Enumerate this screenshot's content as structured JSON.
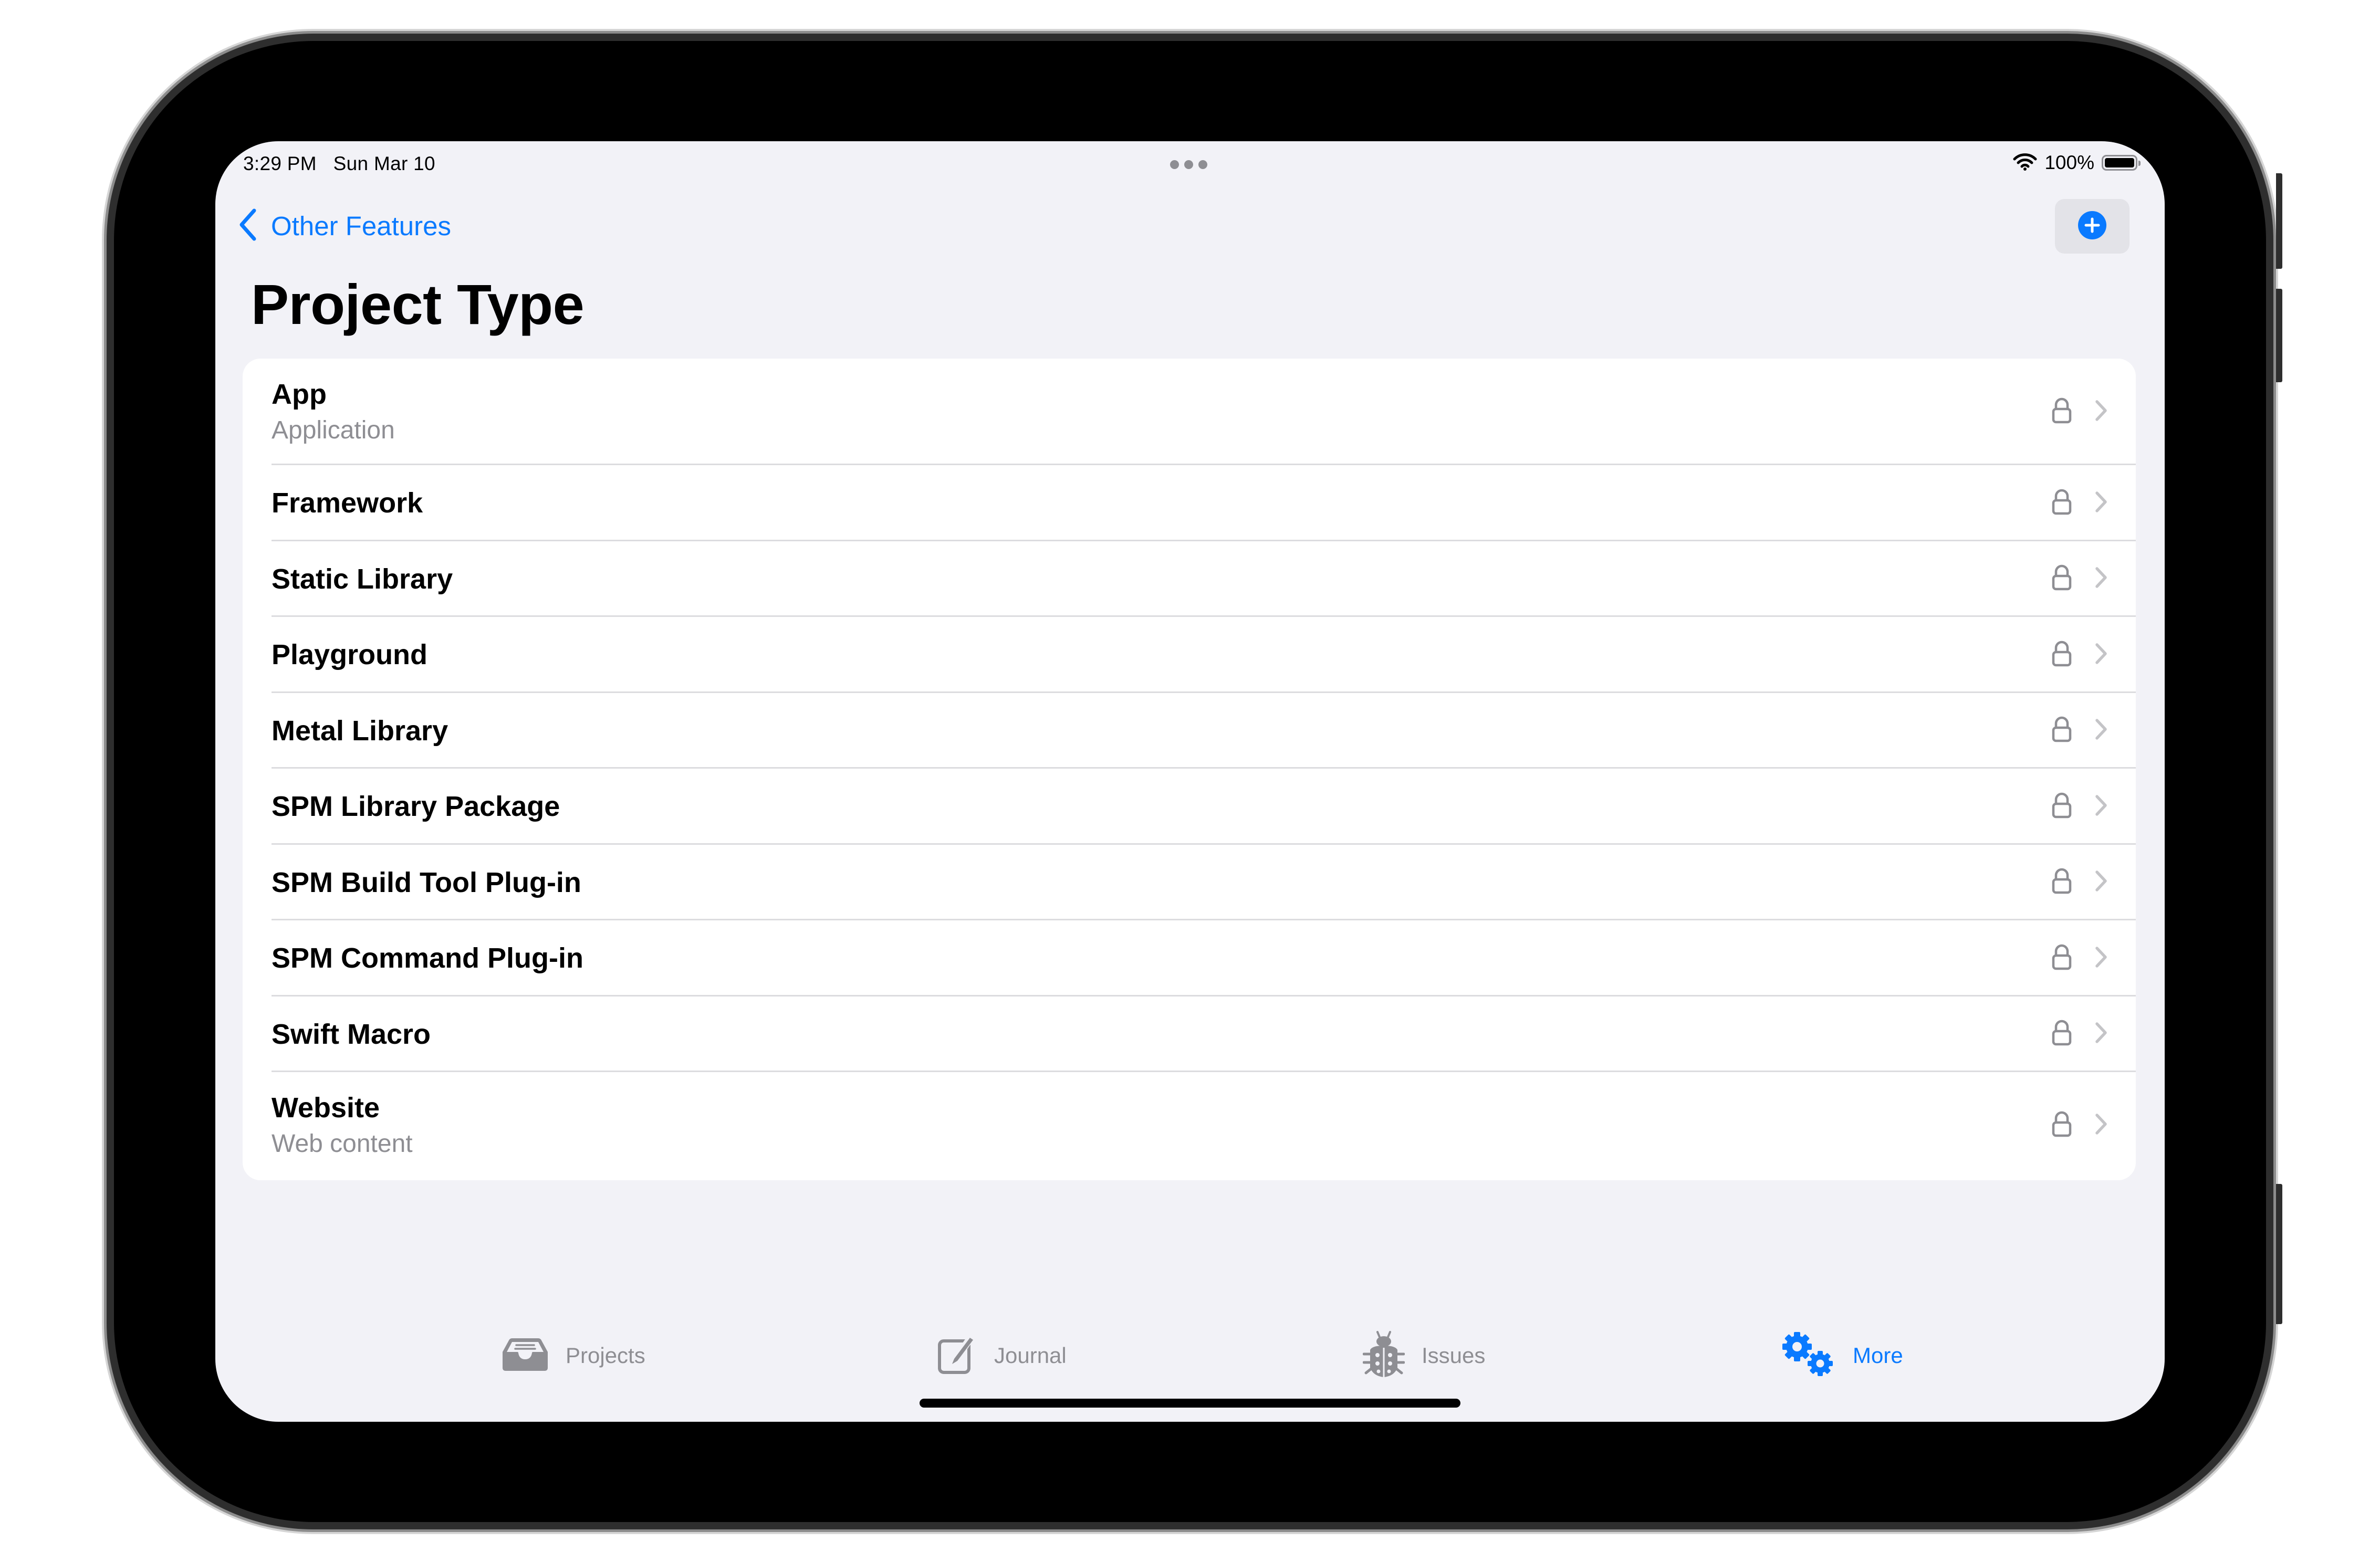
{
  "status_bar": {
    "time": "3:29 PM",
    "date": "Sun Mar 10",
    "battery_percent": "100%",
    "battery_level": 1.0,
    "icons": [
      "wifi-icon",
      "battery-icon",
      "multitasking-dots-icon"
    ]
  },
  "navigation": {
    "back_label": "Other Features",
    "back_icon": "chevron-left-icon",
    "add_icon": "plus-circle-icon"
  },
  "page": {
    "title": "Project Type"
  },
  "list": {
    "items": [
      {
        "label": "App",
        "subtitle": "Application",
        "locked": true
      },
      {
        "label": "Framework",
        "subtitle": null,
        "locked": true
      },
      {
        "label": "Static Library",
        "subtitle": null,
        "locked": true
      },
      {
        "label": "Playground",
        "subtitle": null,
        "locked": true
      },
      {
        "label": "Metal Library",
        "subtitle": null,
        "locked": true
      },
      {
        "label": "SPM Library Package",
        "subtitle": null,
        "locked": true
      },
      {
        "label": "SPM Build Tool Plug-in",
        "subtitle": null,
        "locked": true
      },
      {
        "label": "SPM Command Plug-in",
        "subtitle": null,
        "locked": true
      },
      {
        "label": "Swift Macro",
        "subtitle": null,
        "locked": true
      },
      {
        "label": "Website",
        "subtitle": "Web content",
        "locked": true
      }
    ],
    "trailing_icons": [
      "lock-icon",
      "chevron-right-icon"
    ]
  },
  "tab_bar": {
    "tabs": [
      {
        "label": "Projects",
        "icon": "tray-icon",
        "active": false
      },
      {
        "label": "Journal",
        "icon": "square-pencil-icon",
        "active": false
      },
      {
        "label": "Issues",
        "icon": "ladybug-icon",
        "active": false
      },
      {
        "label": "More",
        "icon": "gears-icon",
        "active": true
      }
    ]
  },
  "colors": {
    "accent": "#0a7aff",
    "background": "#f2f2f7",
    "card": "#ffffff",
    "secondary_text": "#8e8e93",
    "separator": "#dcdcdf",
    "bezel": "#000000"
  }
}
